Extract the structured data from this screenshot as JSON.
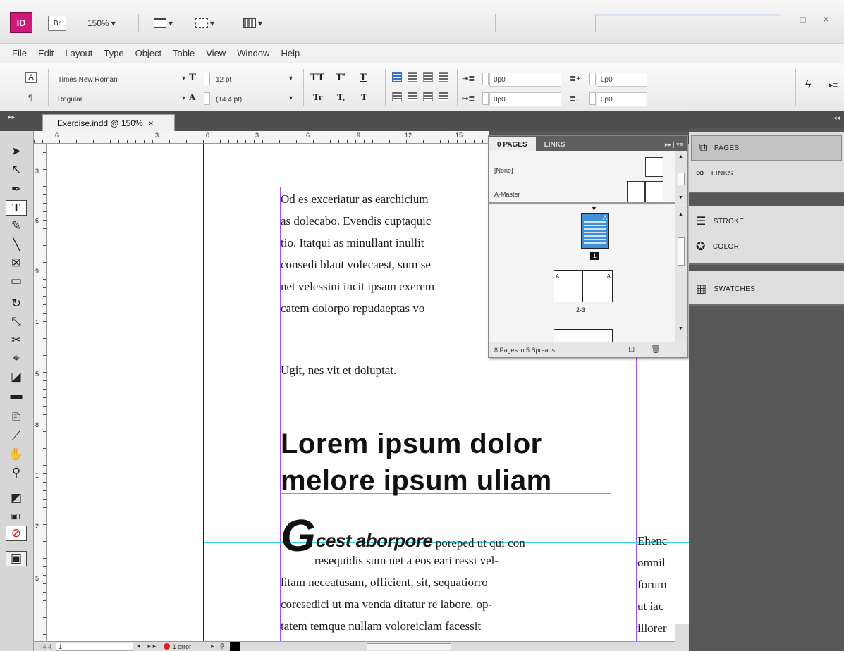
{
  "app": {
    "logo": "ID",
    "bridge": "Br",
    "zoom": "150%",
    "window_controls": "– □ ✕"
  },
  "menu": [
    "File",
    "Edit",
    "Layout",
    "Type",
    "Object",
    "Table",
    "View",
    "Window",
    "Help"
  ],
  "control": {
    "font_family": "Times New Roman",
    "font_style": "Regular",
    "font_size": "12 pt",
    "leading": "(14.4 pt)",
    "indent_left": "0p0",
    "indent_first": "0p0",
    "space_before": "0p0",
    "space_after": "0p0",
    "char_mode": "A",
    "para_mode": "¶",
    "tt_buttons": [
      "TT",
      "T'",
      "T",
      "Tr",
      "T,",
      "T"
    ]
  },
  "document_tab": {
    "title": "Exercise.indd @ 150%",
    "close": "×"
  },
  "rulers": {
    "h_labels": [
      "6",
      "3",
      "0",
      "3",
      "6",
      "9",
      "12",
      "15"
    ],
    "v_labels": [
      "3",
      "6",
      "9",
      "1",
      "5",
      "8",
      "1",
      "2",
      "5"
    ]
  },
  "document": {
    "col1_lines": [
      "Od es exceriatur as earchicium",
      "as dolecabo. Evendis cuptaquic",
      "tio. Itatqui as minullant inullit",
      "consedi blaut volecaest, sum se",
      "net velessini incit ipsam exerem",
      "catem dolorpo repudaeptas vo"
    ],
    "short_line": "Ugit, nes vit et doluptat.",
    "headline1": "Lorem ipsum dolor",
    "headline2": "melore ipsum uliam",
    "dropcap": "G",
    "lead_italic": "cest aborpore",
    "lead_rest": " poreped ut qui con",
    "para_lines": [
      "resequidis sum net a eos eari ressi vel-",
      "litam neceatusam, officient, sit, sequatiorro",
      "coresedici ut ma venda ditatur re labore, op-",
      "tatem temque nullam voloreiclam facessit"
    ],
    "col2_lines": [
      "Ehenc",
      "omnil",
      "forum",
      "ut iac",
      "illorer"
    ]
  },
  "pages_panel": {
    "tabs": [
      "0 PAGES",
      "LINKS"
    ],
    "menu_glyph": "▸▸ | ▾≡",
    "masters": [
      "[None]",
      "A-Master"
    ],
    "page_badge": "1",
    "spread_label": "2-3",
    "master_letter": "A",
    "footer": "8 Pages in 5 Spreads"
  },
  "dock": {
    "group1": [
      "PAGES",
      "LINKS"
    ],
    "group2": [
      "STROKE",
      "COLOR"
    ],
    "group3": [
      "SWATCHES"
    ]
  },
  "status": {
    "page": "1",
    "errors": "1 error",
    "prefix": "I4 4"
  },
  "colors": {
    "accent": "#d0187a",
    "guide_margin": "#a24df0",
    "guide_column": "#5a8ef0",
    "guide_cyan": "#35d6e0",
    "page_thumb": "#3f8fd9",
    "error": "#e02020"
  }
}
